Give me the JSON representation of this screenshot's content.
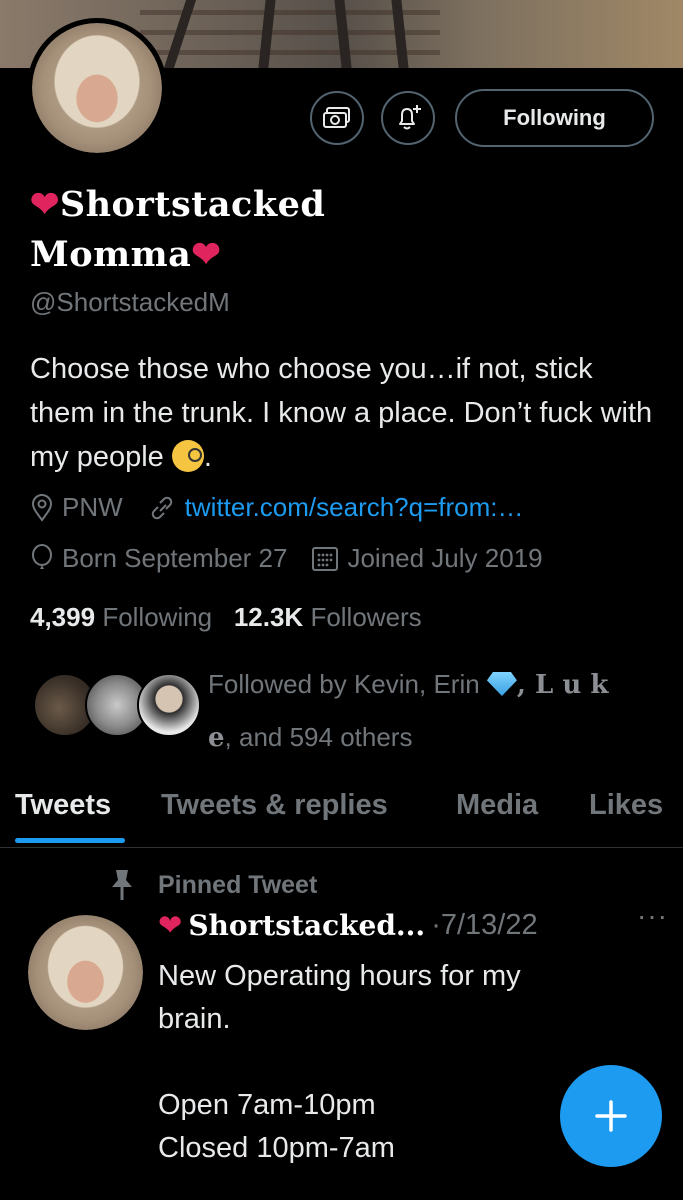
{
  "profile": {
    "display_name_line1": "Shortstacked",
    "display_name_line2": "Momma",
    "heart_glyph": "❤",
    "handle": "@ShortstackedM",
    "bio_text": "Choose those who choose you…if not, stick them in the trunk. I know a place. Don’t fuck with my people",
    "bio_end": ".",
    "location": "PNW",
    "website": "twitter.com/search?q=from:…",
    "birthday": "Born September 27",
    "joined": "Joined July 2019",
    "following_count": "4,399",
    "following_label": "Following",
    "followers_count": "12.3K",
    "followers_label": "Followers",
    "followed_by_prefix": "Followed by Kevin, Erin",
    "followed_by_serif1": ", L u k",
    "followed_by_serif2": "e",
    "followed_by_suffix": ", and 594 others"
  },
  "actions": {
    "follow_state_label": "Following",
    "tips_icon": "money-icon",
    "notify_icon": "bell-plus-icon"
  },
  "tabs": [
    {
      "label": "Tweets",
      "active": true
    },
    {
      "label": "Tweets & replies",
      "active": false
    },
    {
      "label": "Media",
      "active": false
    },
    {
      "label": "Likes",
      "active": false
    }
  ],
  "pinned_tweet": {
    "pinned_label": "Pinned Tweet",
    "author_name": "Shortstacked...",
    "separator": "·",
    "date": "7/13/22",
    "more": "···",
    "text": "New Operating hours for my brain.\n\nOpen 7am-10pm\nClosed 10pm-7am"
  },
  "fab": {
    "label": "+"
  },
  "colors": {
    "accent": "#1d9bf0",
    "background": "#000000",
    "muted": "#71767b",
    "heart": "#e0245e"
  }
}
